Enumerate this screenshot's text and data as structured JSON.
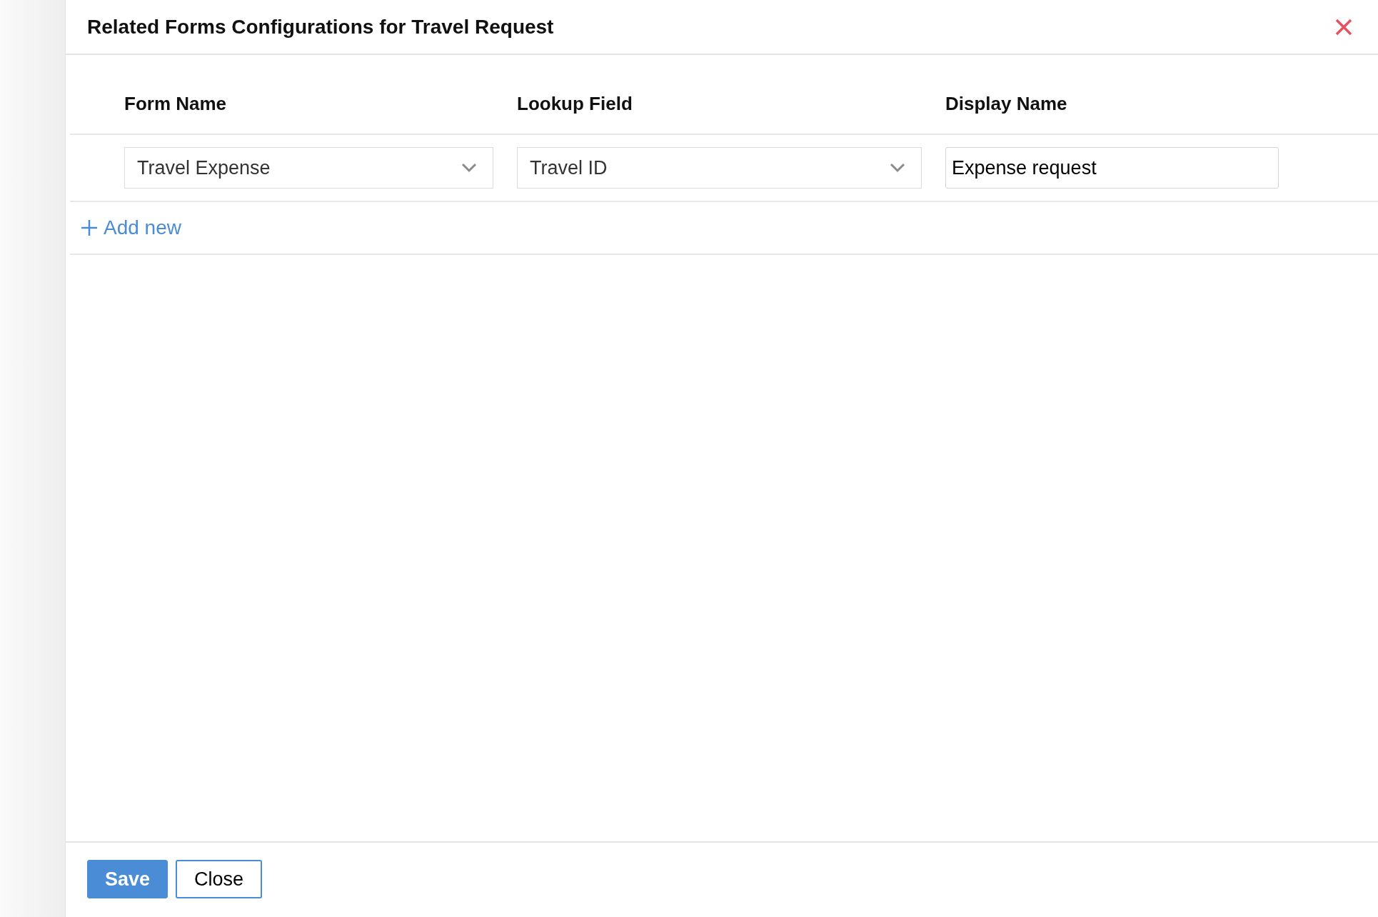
{
  "dialog": {
    "title": "Related Forms Configurations for Travel Request"
  },
  "columns": [
    "Form Name",
    "Lookup Field",
    "Display Name"
  ],
  "rows": [
    {
      "form_name": "Travel Expense",
      "lookup_field": "Travel ID",
      "display_name": "Expense request"
    }
  ],
  "add_new": {
    "label": "Add new"
  },
  "buttons": [
    {
      "label": "Save",
      "kind": "primary"
    },
    {
      "label": "Close",
      "kind": "secondary"
    }
  ]
}
